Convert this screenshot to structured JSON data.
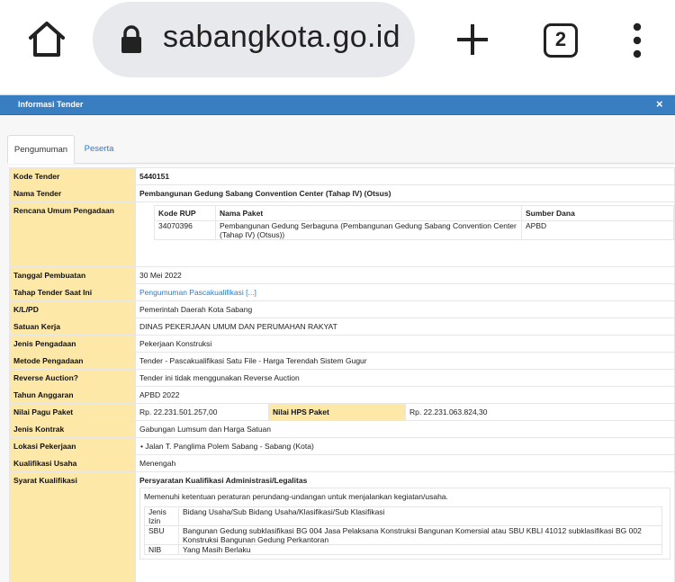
{
  "browser": {
    "url": "sabangkota.go.id",
    "tab_count": "2",
    "icons": [
      "home-icon",
      "lock-icon",
      "plus-icon",
      "tabs-icon",
      "more-vert-icon"
    ]
  },
  "modal": {
    "title": "Informasi Tender",
    "close": "×",
    "tabs": [
      {
        "label": "Pengumuman",
        "active": true
      },
      {
        "label": "Peserta",
        "active": false
      }
    ],
    "colors": {
      "header": "#3a7ec2",
      "label_bg": "#fde8a8",
      "link": "#2a7ad1"
    }
  },
  "tender": {
    "kode_tender": {
      "label": "Kode Tender",
      "value": "5440151"
    },
    "nama_tender": {
      "label": "Nama Tender",
      "value": "Pembangunan Gedung Sabang Convention Center (Tahap IV) (Otsus)"
    },
    "rup": {
      "label": "Rencana Umum Pengadaan",
      "headers": [
        "Kode RUP",
        "Nama Paket",
        "Sumber Dana"
      ],
      "rows": [
        {
          "kode": "34070396",
          "nama": "Pembangunan Gedung Serbaguna (Pembangunan Gedung Sabang Convention Center (Tahap IV) (Otsus))",
          "sumber": "APBD"
        }
      ]
    },
    "tanggal_pembuatan": {
      "label": "Tanggal Pembuatan",
      "value": "30 Mei 2022"
    },
    "tahap_tender": {
      "label": "Tahap Tender Saat Ini",
      "value": "Pengumuman Pascakualifikasi [...]"
    },
    "klpd": {
      "label": "K/L/PD",
      "value": "Pemerintah Daerah Kota Sabang"
    },
    "satuan_kerja": {
      "label": "Satuan Kerja",
      "value": "DINAS PEKERJAAN UMUM DAN PERUMAHAN RAKYAT"
    },
    "jenis_pengadaan": {
      "label": "Jenis Pengadaan",
      "value": "Pekerjaan Konstruksi"
    },
    "metode_pengadaan": {
      "label": "Metode Pengadaan",
      "value": "Tender - Pascakualifikasi Satu File - Harga Terendah Sistem Gugur"
    },
    "reverse_auction": {
      "label": "Reverse Auction?",
      "value": "Tender ini tidak menggunakan Reverse Auction"
    },
    "tahun_anggaran": {
      "label": "Tahun Anggaran",
      "value": "APBD 2022"
    },
    "nilai_pagu": {
      "label": "Nilai Pagu Paket",
      "value": "Rp. 22.231.501.257,00"
    },
    "nilai_hps": {
      "label": "Nilai HPS Paket",
      "value": "Rp. 22.231.063.824,30"
    },
    "jenis_kontrak": {
      "label": "Jenis Kontrak",
      "value": "Gabungan Lumsum dan Harga Satuan"
    },
    "lokasi": {
      "label": "Lokasi Pekerjaan",
      "value": "Jalan T. Panglima Polem Sabang - Sabang (Kota)"
    },
    "kualifikasi_usaha": {
      "label": "Kualifikasi Usaha",
      "value": "Menengah"
    },
    "syarat": {
      "label": "Syarat Kualifikasi",
      "heading": "Persyaratan Kualifikasi Administrasi/Legalitas",
      "intro": "Memenuhi ketentuan peraturan perundang-undangan untuk menjalankan kegiatan/usaha.",
      "izin": [
        {
          "key": "Jenis Izin",
          "value": "Bidang Usaha/Sub Bidang Usaha/Klasifikasi/Sub Klasifikasi"
        },
        {
          "key": "SBU",
          "value": "Bangunan Gedung subklasifikasi BG 004 Jasa Pelaksana Konstruksi Bangunan Komersial atau SBU KBLI 41012 subklasifikasi BG 002 Konstruksi Bangunan Gedung Perkantoran"
        },
        {
          "key": "NIB",
          "value": "Yang Masih Berlaku"
        }
      ]
    }
  }
}
